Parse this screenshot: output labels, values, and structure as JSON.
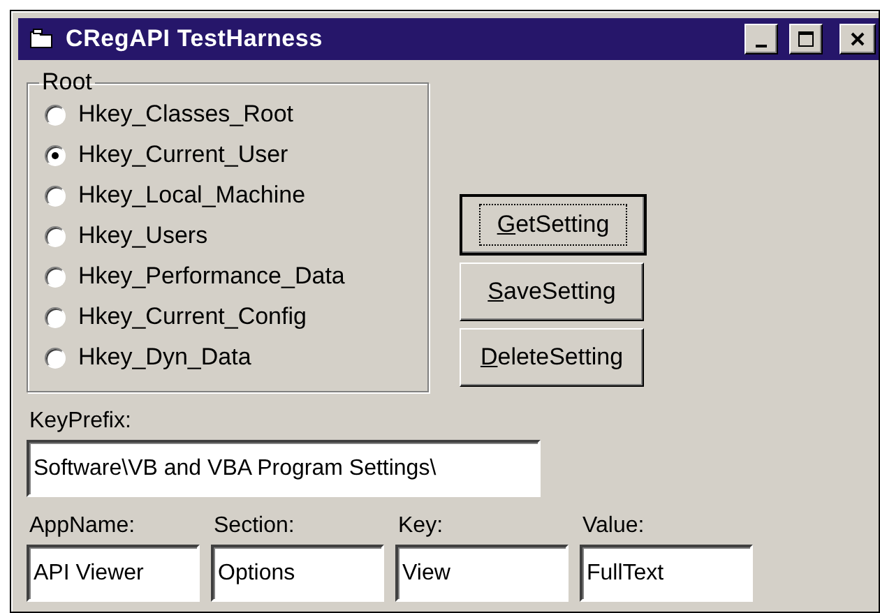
{
  "window": {
    "title": "CRegAPI TestHarness",
    "controls": [
      {
        "kind": "minimize"
      },
      {
        "kind": "maximize"
      },
      {
        "kind": "close"
      }
    ]
  },
  "root_group": {
    "title": "Root",
    "options": [
      {
        "label": "Hkey_Classes_Root",
        "selected": false
      },
      {
        "label": "Hkey_Current_User",
        "selected": true
      },
      {
        "label": "Hkey_Local_Machine",
        "selected": false
      },
      {
        "label": "Hkey_Users",
        "selected": false
      },
      {
        "label": "Hkey_Performance_Data",
        "selected": false
      },
      {
        "label": "Hkey_Current_Config",
        "selected": false
      },
      {
        "label": "Hkey_Dyn_Data",
        "selected": false
      }
    ]
  },
  "buttons": [
    {
      "label": "GetSetting",
      "focused": true,
      "underline_first": true
    },
    {
      "label": "SaveSetting",
      "focused": false,
      "underline_first": true
    },
    {
      "label": "DeleteSetting",
      "focused": false,
      "underline_first": true
    }
  ],
  "key_prefix": {
    "label": "KeyPrefix:",
    "value": "Software\\VB and VBA Program Settings\\"
  },
  "fields": [
    {
      "label": "AppName:",
      "value": "API Viewer"
    },
    {
      "label": "Section:",
      "value": "Options"
    },
    {
      "label": "Key:",
      "value": "View"
    },
    {
      "label": "Value:",
      "value": "FullText"
    }
  ]
}
